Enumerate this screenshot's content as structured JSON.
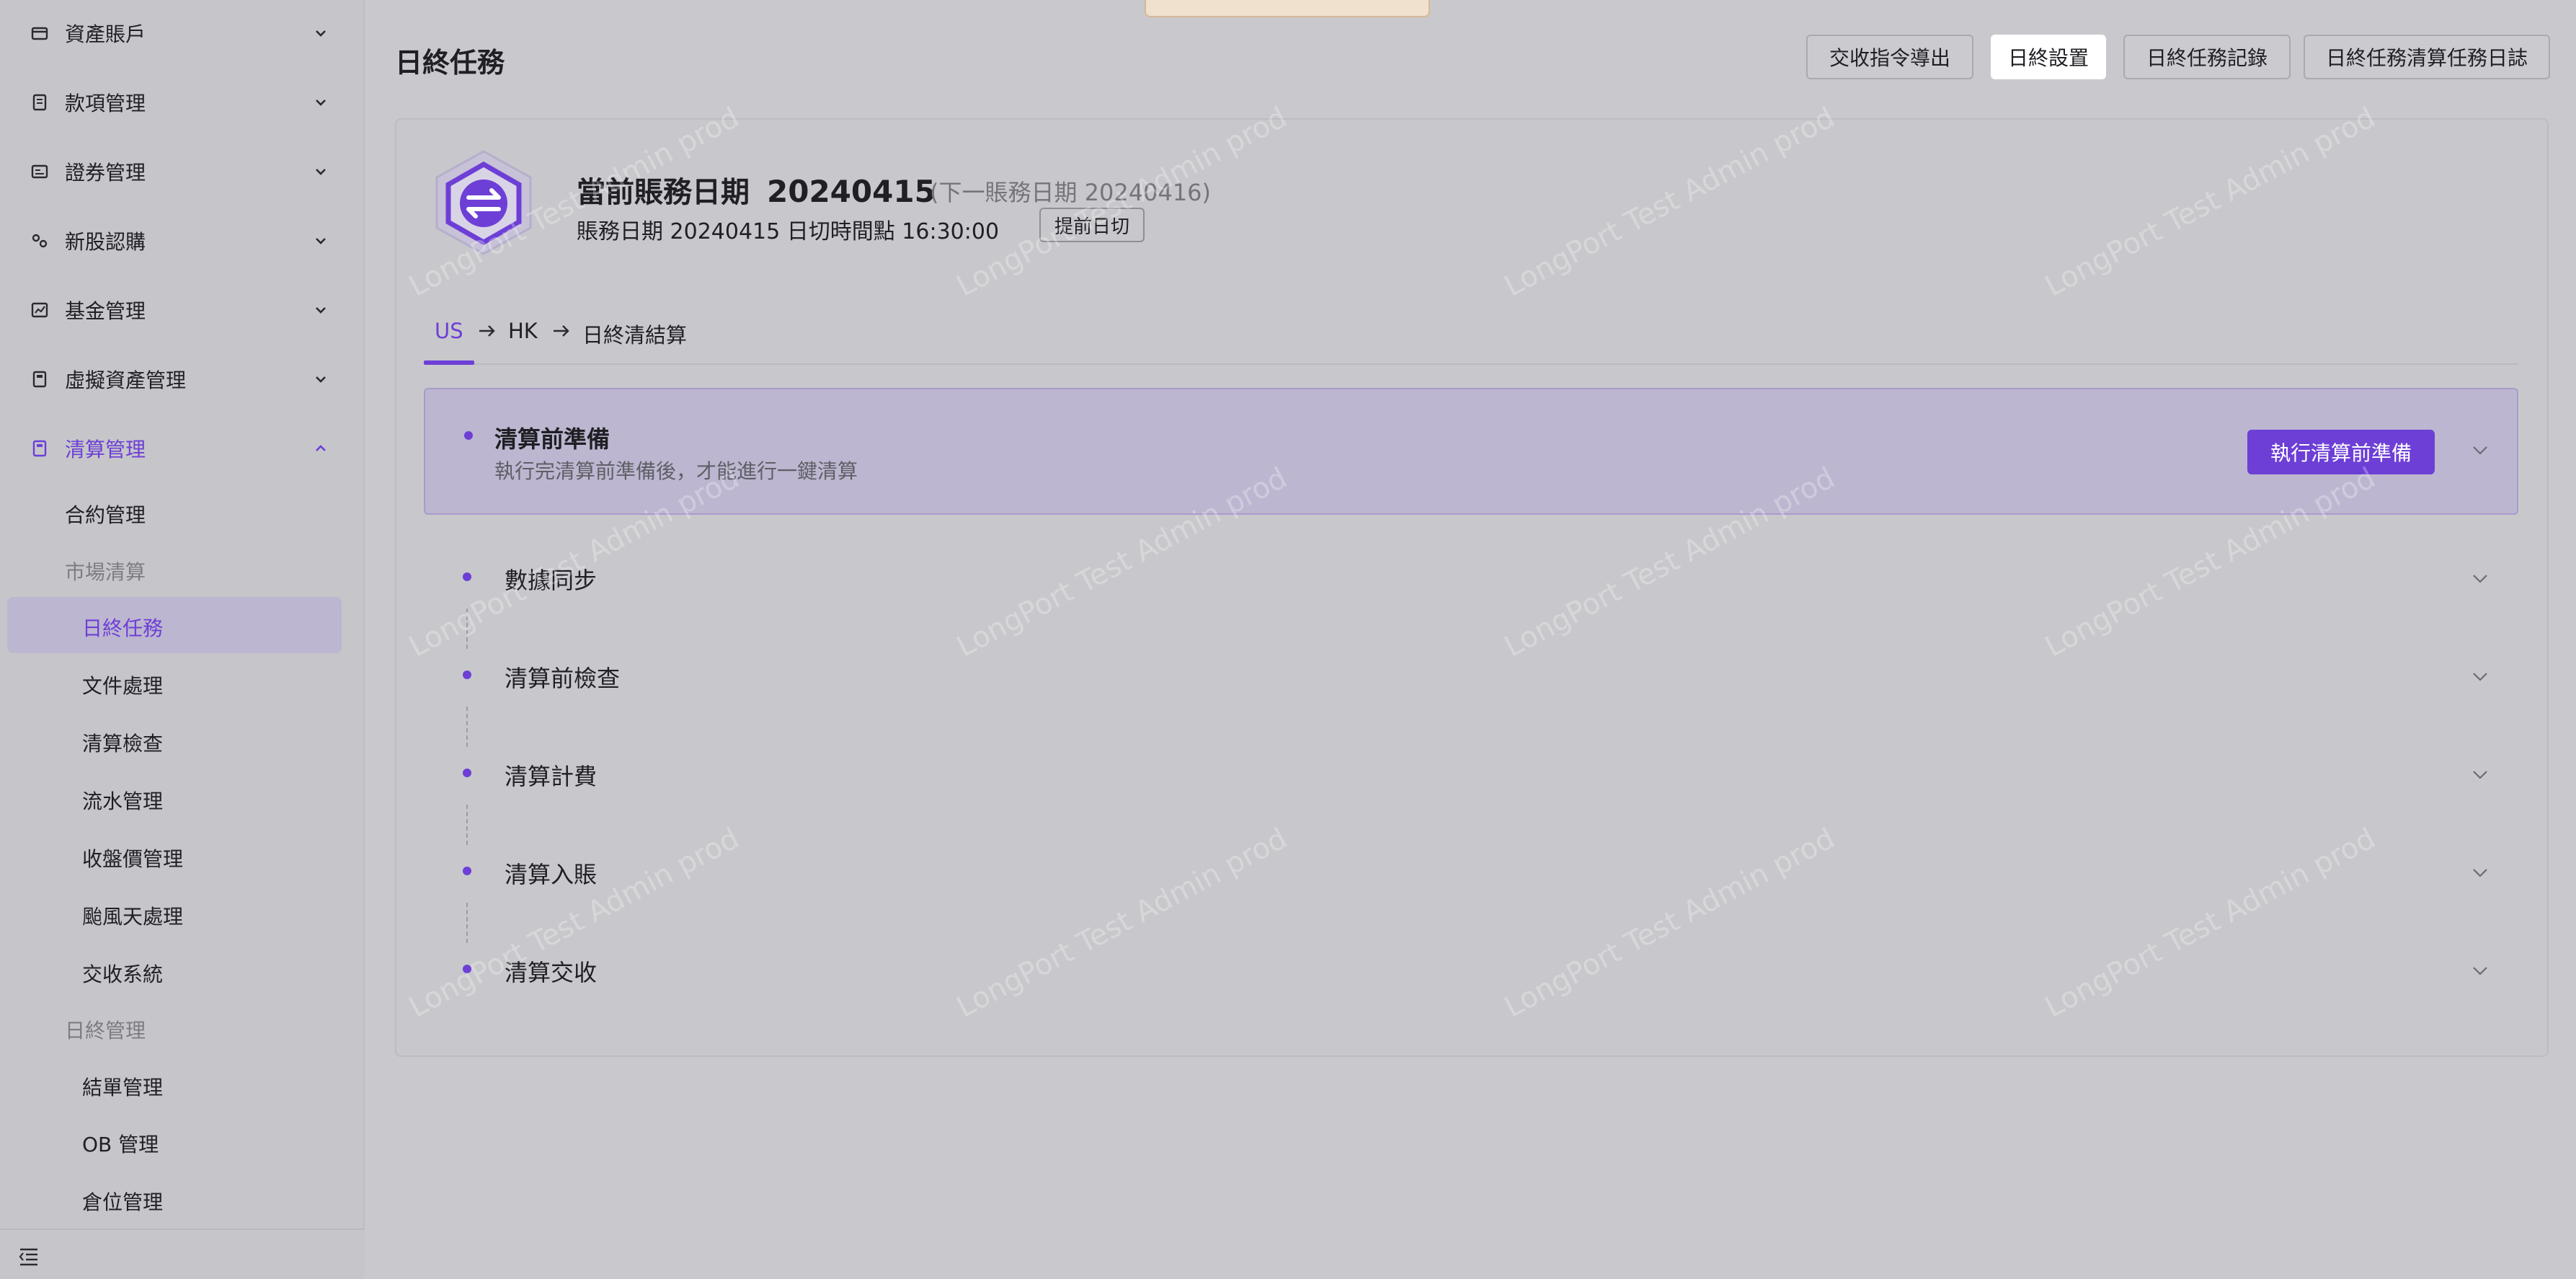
{
  "sidebar": {
    "groups": [
      {
        "label": "資產賬戶",
        "icon": "wallet-icon"
      },
      {
        "label": "款項管理",
        "icon": "document-icon"
      },
      {
        "label": "證券管理",
        "icon": "card-icon"
      },
      {
        "label": "新股認購",
        "icon": "gears-icon"
      },
      {
        "label": "基金管理",
        "icon": "chart-icon"
      },
      {
        "label": "虛擬資產管理",
        "icon": "calculator-icon"
      },
      {
        "label": "清算管理",
        "icon": "calculator-icon"
      }
    ],
    "sub": {
      "contract": "合約管理",
      "market_header": "市場清算",
      "market_items": [
        "日終任務",
        "文件處理",
        "清算檢查",
        "流水管理",
        "收盤價管理",
        "颱風天處理",
        "交收系統"
      ],
      "eod_header": "日終管理",
      "eod_items": [
        "結單管理",
        "OB 管理",
        "倉位管理"
      ]
    },
    "active_color": "#6d3fd6"
  },
  "header": {
    "title": "日終任務",
    "buttons": [
      "交收指令導出",
      "日終設置",
      "日終任務記錄",
      "日終任務清算任務日誌"
    ]
  },
  "info": {
    "current_label": "當前賬務日期",
    "current_date": "20240415",
    "next_text": "(下一賬務日期   20240416)",
    "sub_text": "賬務日期 20240415   日切時間點 16:30:00",
    "early_button": "提前日切"
  },
  "steps": [
    "US",
    "HK",
    "日終清結算"
  ],
  "panel": {
    "title": "清算前準備",
    "desc": "執行完清算前準備後，才能進行一鍵清算",
    "exec_button": "執行清算前準備"
  },
  "rows": [
    "數據同步",
    "清算前檢查",
    "清算計費",
    "清算入賬",
    "清算交收"
  ],
  "watermark": "LongPort Test Admin prod"
}
